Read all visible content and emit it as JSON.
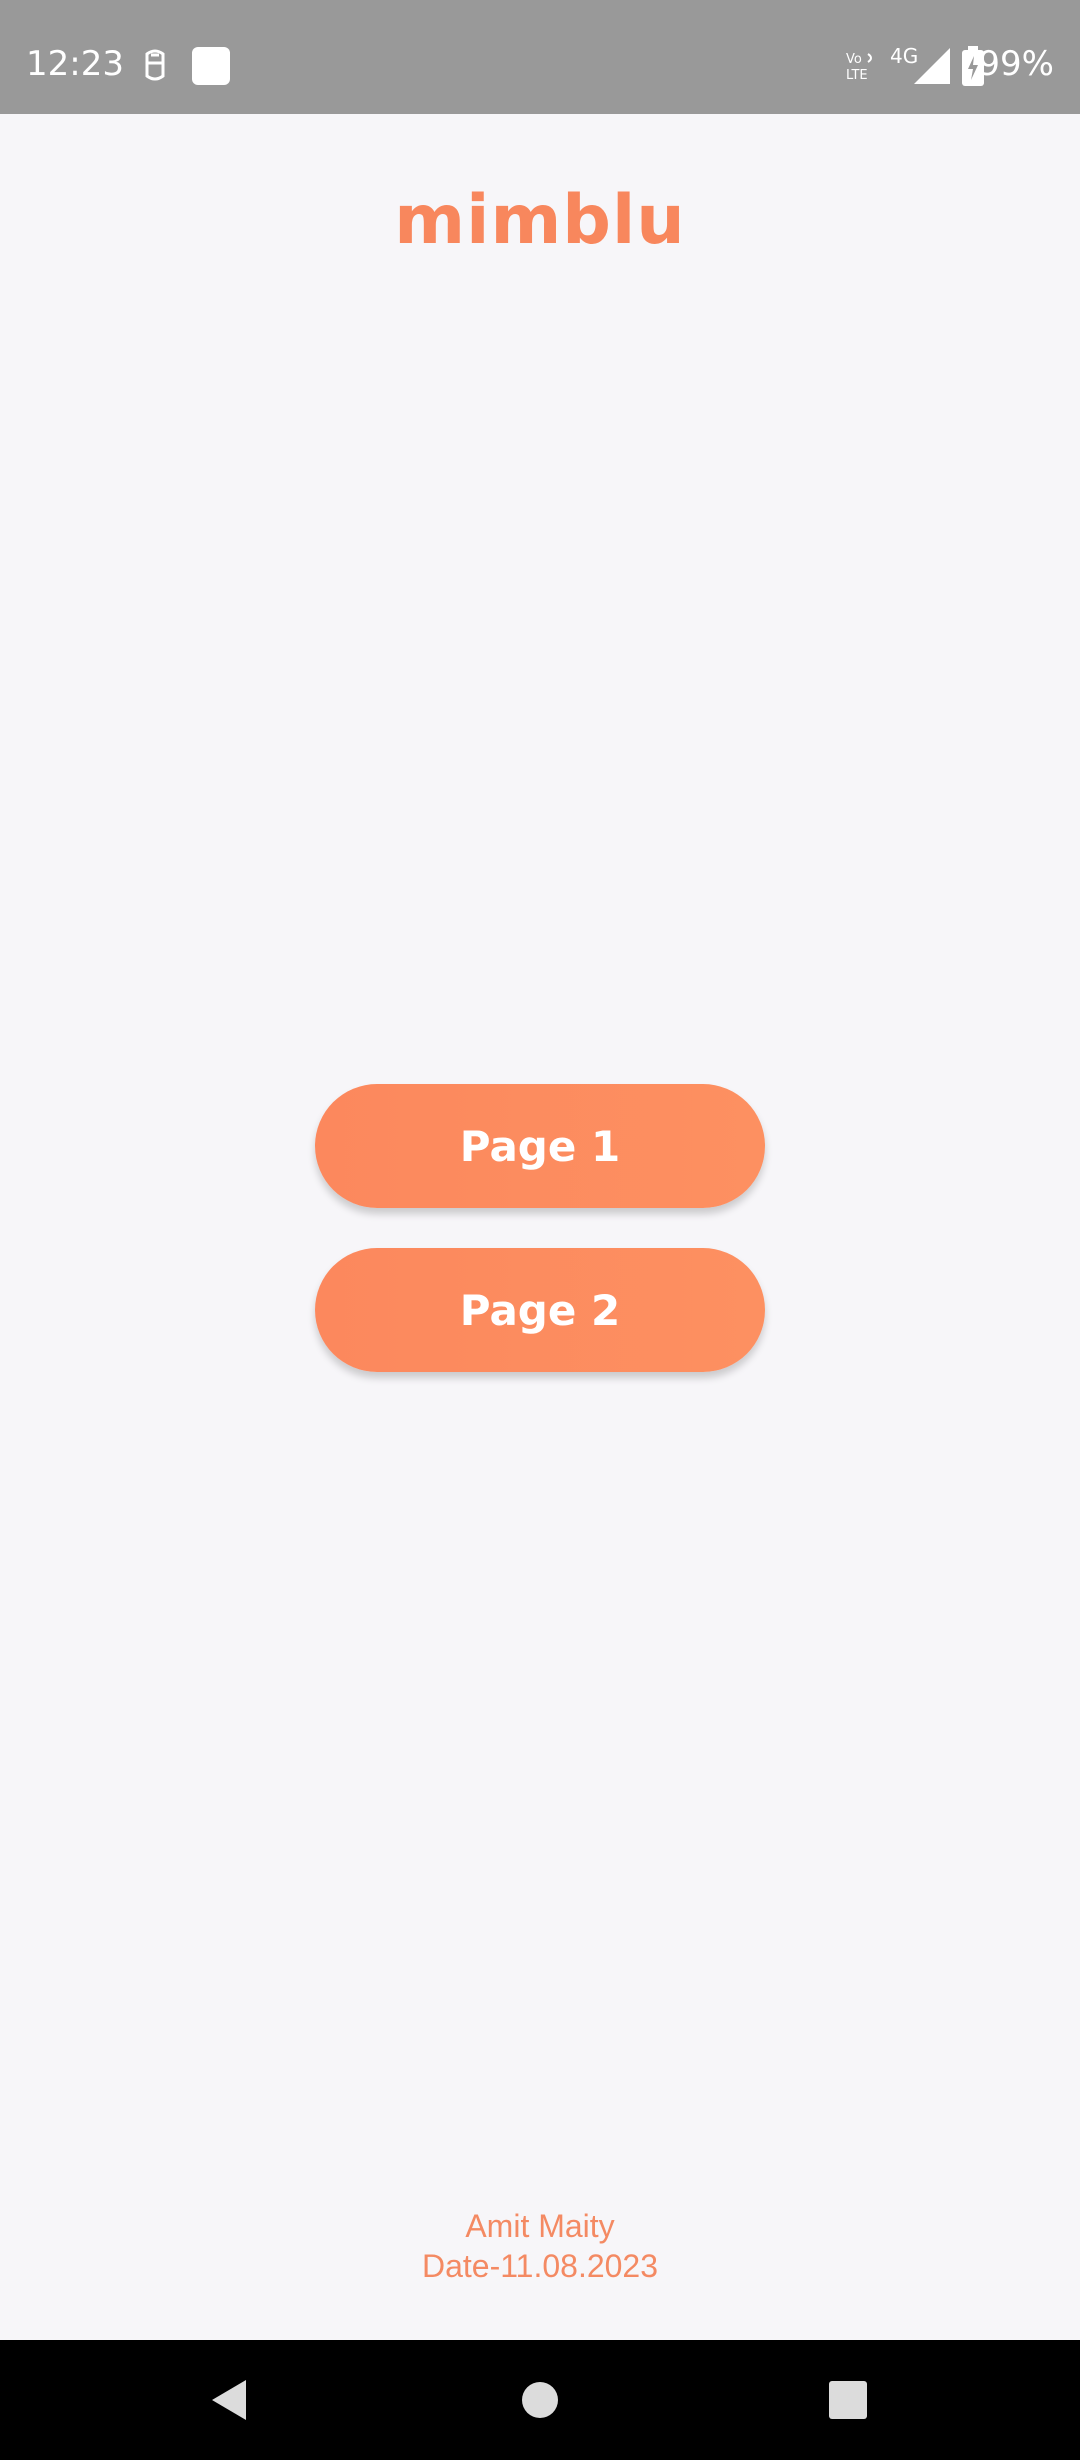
{
  "status_bar": {
    "time": "12:23",
    "network_label": "4G",
    "volte_label": "Vo LTE",
    "battery_percent": "99%",
    "icons": [
      "vpn-key-icon",
      "notification-square-icon",
      "volte-icon",
      "signal-4g-icon",
      "battery-charging-icon"
    ]
  },
  "app": {
    "logo_text": "mimblu",
    "accent_color": "#f8875d"
  },
  "buttons": {
    "page1_label": "Page 1",
    "page2_label": "Page 2"
  },
  "credits": {
    "author": "Amit Maity",
    "date": "Date-11.08.2023"
  },
  "nav_bar": {
    "icons": [
      "back-icon",
      "home-icon",
      "recents-icon"
    ]
  }
}
